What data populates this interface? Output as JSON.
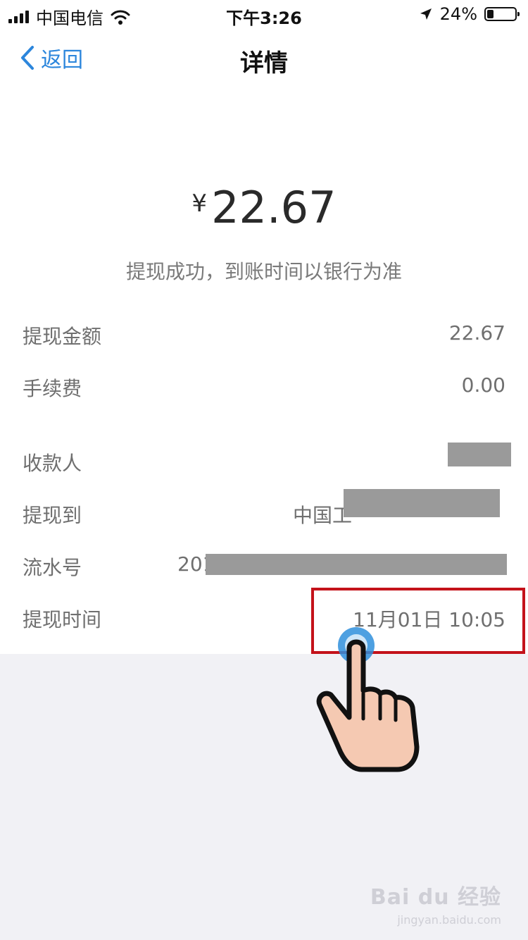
{
  "status_bar": {
    "carrier": "中国电信",
    "time": "下午3:26",
    "battery_percent_text": "24%",
    "battery_level": 0.24
  },
  "nav": {
    "back_label": "返回",
    "title": "详情"
  },
  "amount": {
    "currency": "¥",
    "value": "22.67"
  },
  "status_message": "提现成功，到账时间以银行为准",
  "rows": [
    {
      "label": "提现金额",
      "value": "22.67"
    },
    {
      "label": "手续费",
      "value": "0.00"
    },
    {
      "label": "收款人",
      "value": ""
    },
    {
      "label": "提现到",
      "value": "中国工"
    },
    {
      "label": "流水号",
      "value": "201"
    },
    {
      "label": "提现时间",
      "value": "11月01日 10:05"
    }
  ],
  "watermark": {
    "line1": "Bai du 经验",
    "line2": "jingyan.baidu.com"
  },
  "colors": {
    "accent": "#2c86dc",
    "highlight": "#c4121a",
    "background": "#f1f1f5"
  }
}
